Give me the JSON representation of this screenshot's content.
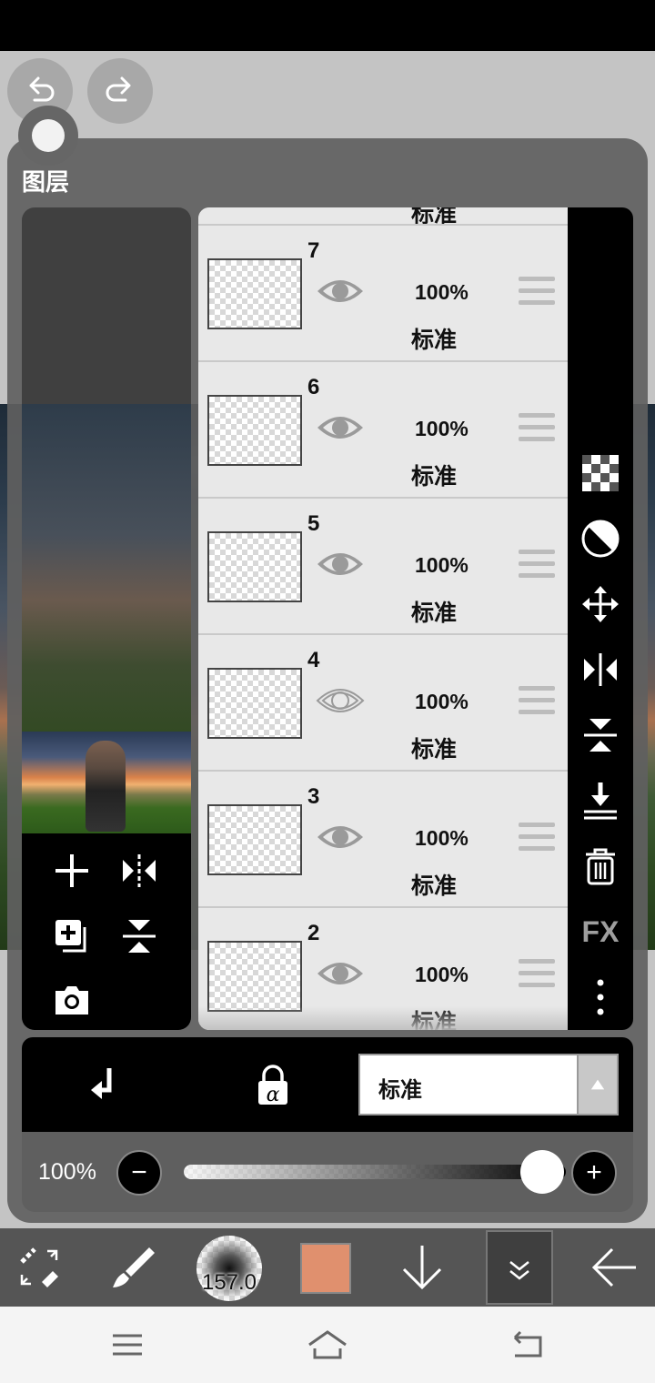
{
  "panel": {
    "title": "图层"
  },
  "layers_partial_top": {
    "blend": "标准"
  },
  "layers": [
    {
      "number": "7",
      "opacity": "100%",
      "blend": "标准",
      "visible": true
    },
    {
      "number": "6",
      "opacity": "100%",
      "blend": "标准",
      "visible": true
    },
    {
      "number": "5",
      "opacity": "100%",
      "blend": "标准",
      "visible": true
    },
    {
      "number": "4",
      "opacity": "100%",
      "blend": "标准",
      "visible": false
    },
    {
      "number": "3",
      "opacity": "100%",
      "blend": "标准",
      "visible": true
    },
    {
      "number": "2",
      "opacity": "100%",
      "blend": "标准",
      "visible": true
    }
  ],
  "side_tools": [
    "checker-icon",
    "invert-icon",
    "move-icon",
    "flip-horizontal-icon",
    "flip-vertical-icon",
    "merge-down-icon",
    "trash-icon",
    "FX",
    "more-icon"
  ],
  "fx_label": "FX",
  "blend_bar": {
    "mode": "标准"
  },
  "opacity_bar": {
    "label": "100%",
    "value": 1.0,
    "minus": "−",
    "plus": "+"
  },
  "toolbar": {
    "brush_size": "157.0",
    "color": "#e0906e"
  },
  "colors": {
    "panel": "#606060",
    "list_bg": "#e8e8e8",
    "toolbar": "#555555"
  }
}
